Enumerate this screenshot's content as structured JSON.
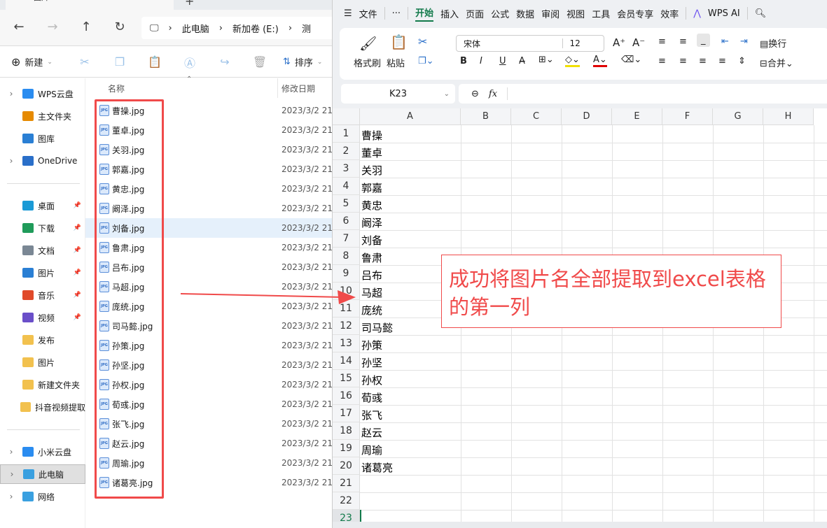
{
  "explorer": {
    "tab_title": "图片",
    "breadcrumb": [
      "此电脑",
      "新加卷 (E:)",
      "测"
    ],
    "toolbar": {
      "new_label": "新建",
      "sort_label": "排序"
    },
    "columns": {
      "name": "名称",
      "date": "修改日期"
    },
    "sidebar": [
      {
        "label": "WPS云盘",
        "chev": true
      },
      {
        "label": "主文件夹"
      },
      {
        "label": "图库"
      },
      {
        "label": "OneDrive",
        "chev": true
      },
      {
        "label": "桌面",
        "pin": true
      },
      {
        "label": "下载",
        "pin": true
      },
      {
        "label": "文档",
        "pin": true
      },
      {
        "label": "图片",
        "pin": true
      },
      {
        "label": "音乐",
        "pin": true
      },
      {
        "label": "视频",
        "pin": true
      },
      {
        "label": "发布"
      },
      {
        "label": "图片"
      },
      {
        "label": "新建文件夹"
      },
      {
        "label": "抖音视频提取"
      },
      {
        "label": "小米云盘",
        "chev": true
      },
      {
        "label": "此电脑",
        "chev": true,
        "selected": true
      },
      {
        "label": "网络",
        "chev": true
      }
    ],
    "files": [
      {
        "name": "曹操.jpg",
        "date": "2023/3/2 21:"
      },
      {
        "name": "董卓.jpg",
        "date": "2023/3/2 21:"
      },
      {
        "name": "关羽.jpg",
        "date": "2023/3/2 21:"
      },
      {
        "name": "郭嘉.jpg",
        "date": "2023/3/2 21:"
      },
      {
        "name": "黄忠.jpg",
        "date": "2023/3/2 21:"
      },
      {
        "name": "阚泽.jpg",
        "date": "2023/3/2 21:"
      },
      {
        "name": "刘备.jpg",
        "date": "2023/3/2 21:"
      },
      {
        "name": "鲁肃.jpg",
        "date": "2023/3/2 21:"
      },
      {
        "name": "吕布.jpg",
        "date": "2023/3/2 21:"
      },
      {
        "name": "马超.jpg",
        "date": "2023/3/2 21:"
      },
      {
        "name": "庞统.jpg",
        "date": "2023/3/2 21:"
      },
      {
        "name": "司马懿.jpg",
        "date": "2023/3/2 21:"
      },
      {
        "name": "孙策.jpg",
        "date": "2023/3/2 21:"
      },
      {
        "name": "孙坚.jpg",
        "date": "2023/3/2 21:"
      },
      {
        "name": "孙权.jpg",
        "date": "2023/3/2 21:"
      },
      {
        "name": "荀彧.jpg",
        "date": "2023/3/2 21:"
      },
      {
        "name": "张飞.jpg",
        "date": "2023/3/2 21:"
      },
      {
        "name": "赵云.jpg",
        "date": "2023/3/2 21:"
      },
      {
        "name": "周瑜.jpg",
        "date": "2023/3/2 21:"
      },
      {
        "name": "诸葛亮.jpg",
        "date": "2023/3/2 21:"
      }
    ],
    "selected_index": 6
  },
  "wps": {
    "menu": [
      "文件",
      "···",
      "开始",
      "插入",
      "页面",
      "公式",
      "数据",
      "审阅",
      "视图",
      "工具",
      "会员专享",
      "效率",
      "WPS AI"
    ],
    "active_menu": "开始",
    "ribbon": {
      "format_painter": "格式刷",
      "paste": "粘贴",
      "font": "宋体",
      "font_size": "12",
      "wrap": "换行",
      "merge": "合并",
      "bold": "B",
      "italic": "I",
      "underline": "U"
    },
    "name_box": "K23",
    "fx": "fx",
    "columns": [
      "A",
      "B",
      "C",
      "D",
      "E",
      "F",
      "G",
      "H"
    ],
    "rows": [
      "曹操",
      "董卓",
      "关羽",
      "郭嘉",
      "黄忠",
      "阚泽",
      "刘备",
      "鲁肃",
      "吕布",
      "马超",
      "庞统",
      "司马懿",
      "孙策",
      "孙坚",
      "孙权",
      "荀彧",
      "张飞",
      "赵云",
      "周瑜",
      "诸葛亮",
      "",
      "",
      ""
    ]
  },
  "annotation": {
    "text": "成功将图片名全部提取到excel表格的第一列",
    "color": "#f04a4a"
  }
}
